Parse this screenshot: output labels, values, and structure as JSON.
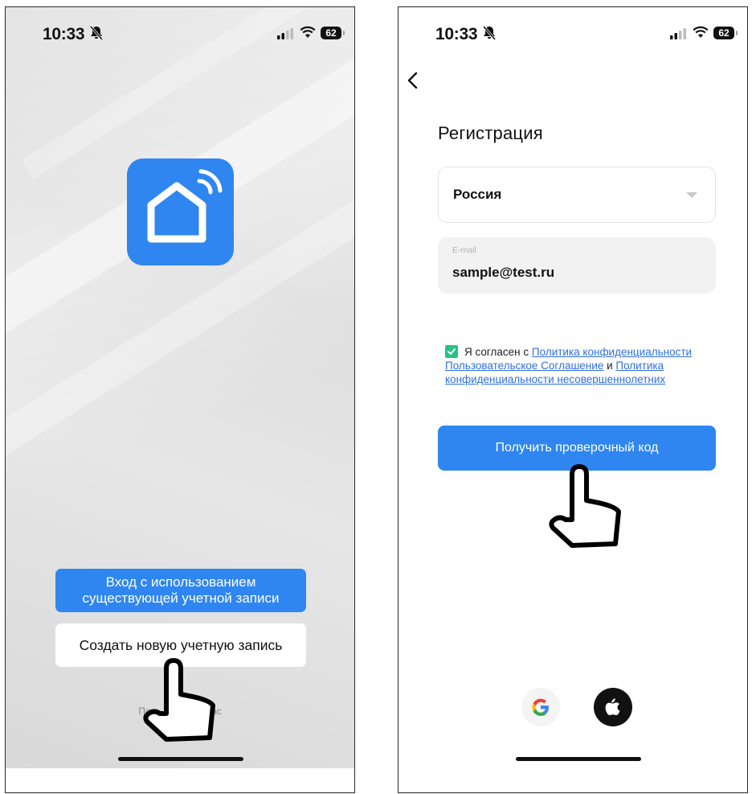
{
  "left_screen": {
    "status": {
      "time": "10:33",
      "battery": "62"
    },
    "app_icon": "smart-home-icon",
    "login_button": "Вход с использованием существующей учетной записи",
    "create_button": "Создать новую учетную запись",
    "footer_left": "По",
    "footer_right": "ас"
  },
  "right_screen": {
    "status": {
      "time": "10:33",
      "battery": "62"
    },
    "title": "Регистрация",
    "country": {
      "value": "Россия"
    },
    "email": {
      "label": "E-mail",
      "value": "sample@test.ru"
    },
    "agreement": {
      "prefix": "Я согласен с",
      "link1": "Политика конфиденциальности",
      "link2": "Пользовательское Соглашение",
      "conjunction": "и",
      "link3": "Политика конфиденциальности несовершеннолетних"
    },
    "code_button": "Получить проверочный код",
    "social": [
      "google-icon",
      "apple-icon"
    ]
  },
  "colors": {
    "accent": "#2f86f0",
    "checkbox": "#26c281",
    "link": "#2f6fe0"
  }
}
